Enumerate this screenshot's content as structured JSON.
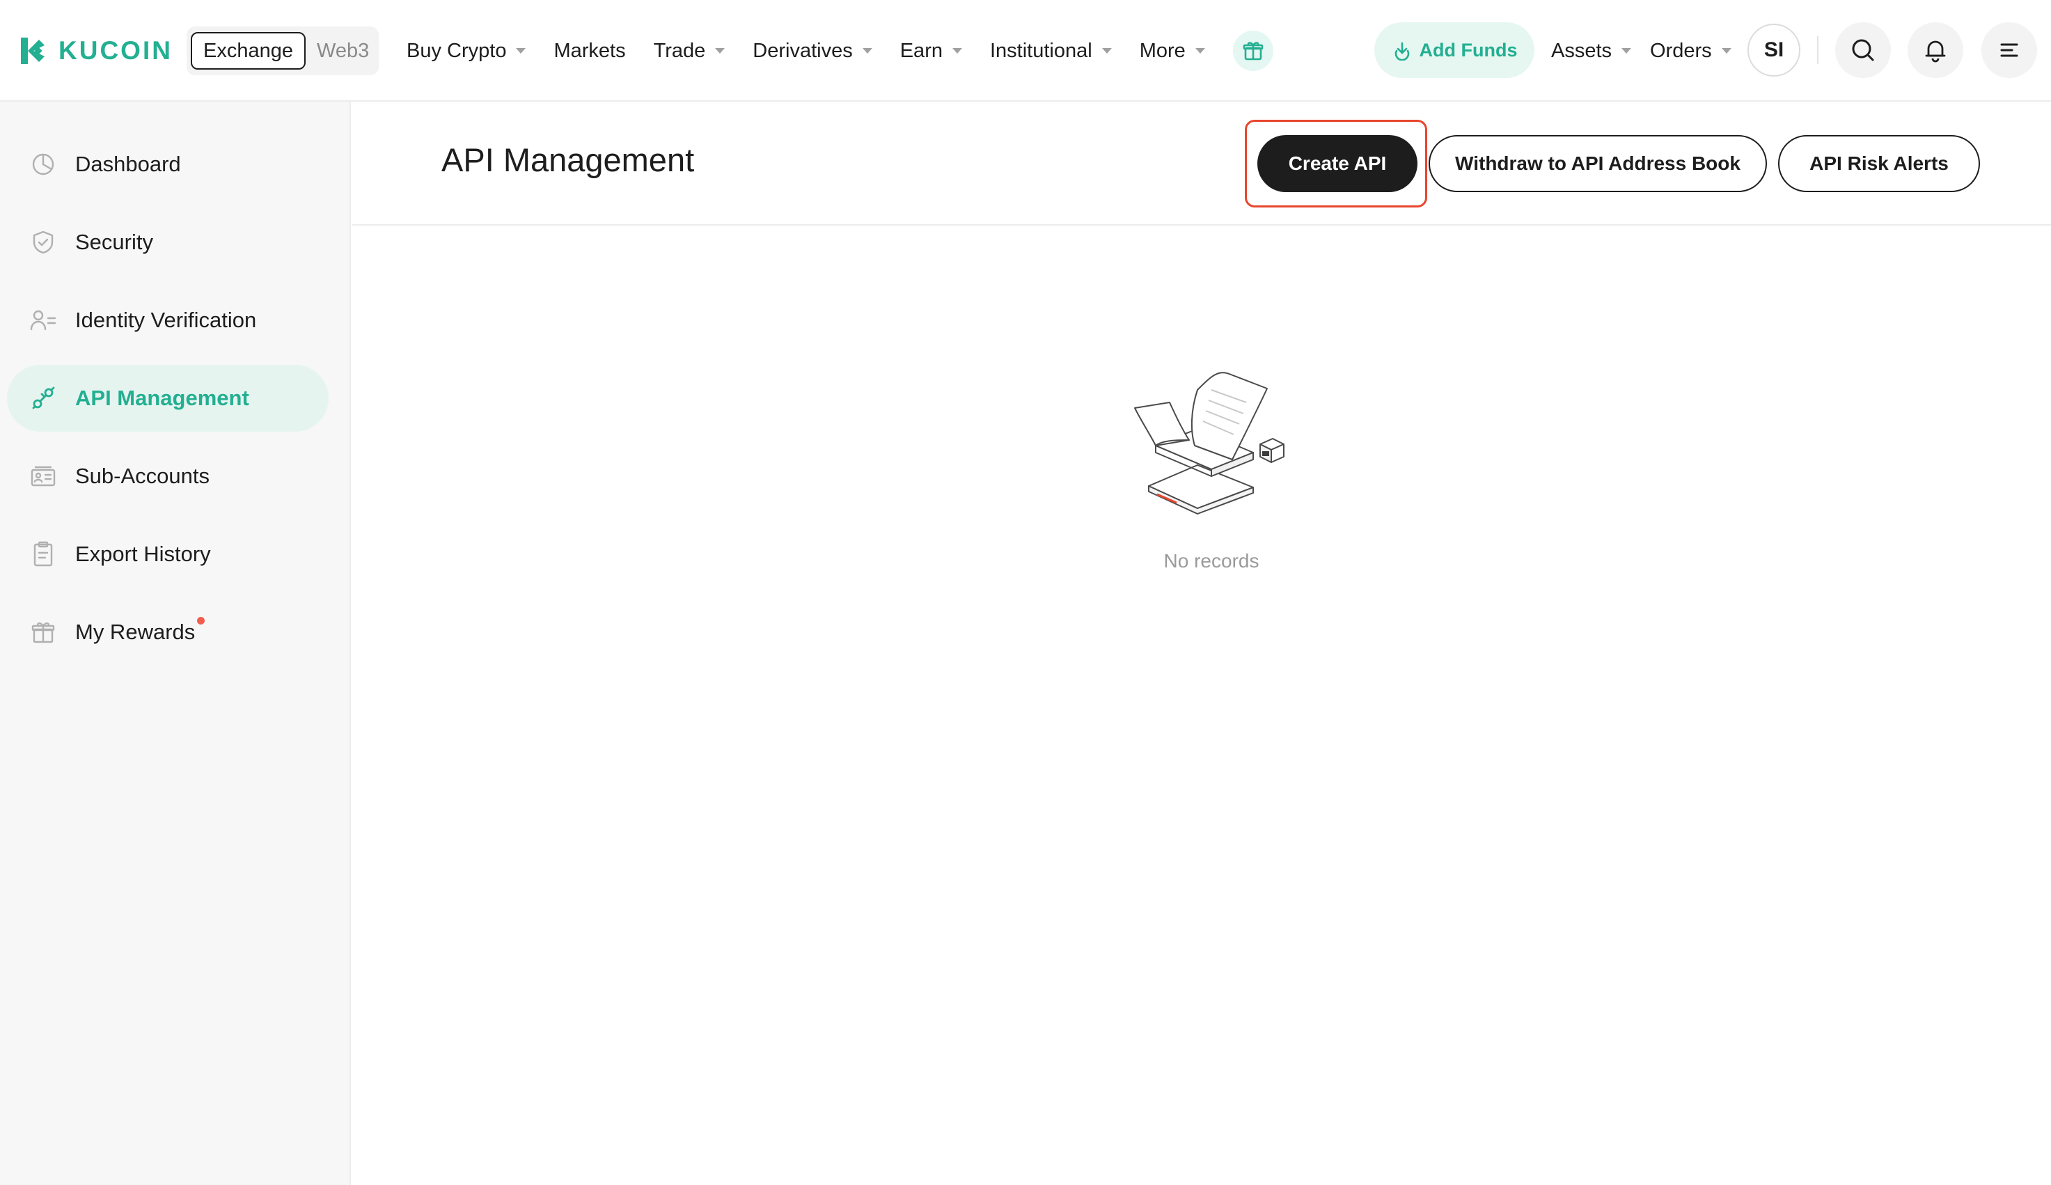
{
  "brand": {
    "name": "KUCOIN",
    "color": "#23af91"
  },
  "header": {
    "switcher": {
      "active": "Exchange",
      "inactive": "Web3"
    },
    "nav": [
      {
        "label": "Buy Crypto",
        "dropdown": true
      },
      {
        "label": "Markets",
        "dropdown": false
      },
      {
        "label": "Trade",
        "dropdown": true
      },
      {
        "label": "Derivatives",
        "dropdown": true
      },
      {
        "label": "Earn",
        "dropdown": true
      },
      {
        "label": "Institutional",
        "dropdown": true
      },
      {
        "label": "More",
        "dropdown": true
      }
    ],
    "add_funds": "Add Funds",
    "assets": "Assets",
    "orders": "Orders",
    "avatar_initials": "SI",
    "icons": [
      "gift-icon",
      "search-icon",
      "bell-icon",
      "menu-icon"
    ]
  },
  "sidebar": {
    "items": [
      {
        "label": "Dashboard",
        "icon": "pie-chart-icon",
        "active": false
      },
      {
        "label": "Security",
        "icon": "shield-icon",
        "active": false
      },
      {
        "label": "Identity Verification",
        "icon": "user-id-icon",
        "active": false
      },
      {
        "label": "API Management",
        "icon": "api-link-icon",
        "active": true
      },
      {
        "label": "Sub-Accounts",
        "icon": "sub-accounts-icon",
        "active": false
      },
      {
        "label": "Export History",
        "icon": "clipboard-icon",
        "active": false
      },
      {
        "label": "My Rewards",
        "icon": "gift-icon",
        "active": false,
        "badge_dot": true
      }
    ]
  },
  "main": {
    "title": "API Management",
    "buttons": {
      "create": "Create API",
      "withdraw_book": "Withdraw to API Address Book",
      "risk_alerts": "API Risk Alerts"
    },
    "empty_state": "No records"
  },
  "colors": {
    "accent": "#23af91",
    "highlight": "#e8462e",
    "notification_dot": "#f35d4f"
  }
}
